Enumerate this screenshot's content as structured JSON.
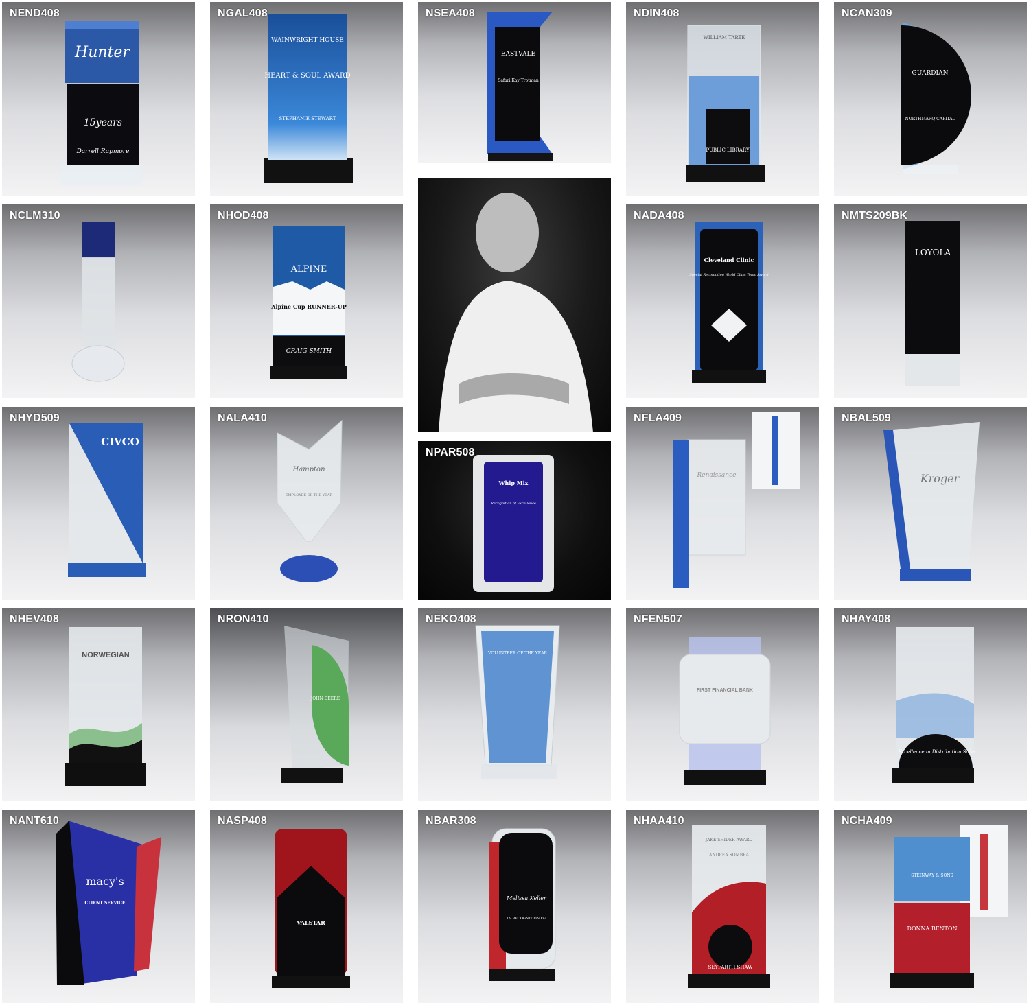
{
  "tiles": [
    {
      "code": "NEND408",
      "text": [
        "Hunter",
        "15years",
        "Darrell Rapmore"
      ]
    },
    {
      "code": "NGAL408",
      "text": [
        "WAINWRIGHT HOUSE",
        "HEART & SOUL AWARD",
        "STEPHANIE STEWART"
      ]
    },
    {
      "code": "NSEA408",
      "text": [
        "EASTVALE",
        "Safari Kay Trotman"
      ]
    },
    {
      "code": "NDIN408",
      "text": [
        "WILLIAM TARTE",
        "PUBLIC LIBRARY"
      ]
    },
    {
      "code": "NCAN309",
      "text": [
        "GUARDIAN",
        "NORTHMARQ CAPITAL"
      ]
    },
    {
      "code": "NCLM310",
      "text": []
    },
    {
      "code": "NHOD408",
      "text": [
        "ALPINE",
        "Alpine Cup RUNNER-UP",
        "CRAIG SMITH"
      ]
    },
    {
      "code": "NADA408",
      "text": [
        "Cleveland Clinic",
        "Special Recognition World Class Team Award"
      ]
    },
    {
      "code": "NMTS209BK",
      "text": [
        "LOYOLA"
      ]
    },
    {
      "code": "NHYD509",
      "text": [
        "CIVCO"
      ]
    },
    {
      "code": "NALA410",
      "text": [
        "Hampton",
        "EMPLOYEE OF THE YEAR"
      ]
    },
    {
      "code": "NPAR508",
      "text": [
        "Whip Mix",
        "Recognition of Excellence"
      ]
    },
    {
      "code": "NFLA409",
      "text": [
        "Renaissance"
      ]
    },
    {
      "code": "NBAL509",
      "text": [
        "Kroger"
      ]
    },
    {
      "code": "NHEV408",
      "text": [
        "NORWEGIAN"
      ]
    },
    {
      "code": "NRON410",
      "text": [
        "JOHN DEERE"
      ]
    },
    {
      "code": "NEKO408",
      "text": [
        "VOLUNTEER OF THE YEAR"
      ]
    },
    {
      "code": "NFEN507",
      "text": [
        "FIRST FINANCIAL BANK"
      ]
    },
    {
      "code": "NHAY408",
      "text": [
        "Excellence in Distribution Sales"
      ]
    },
    {
      "code": "NANT610",
      "text": [
        "macy's",
        "CLIENT SERVICE"
      ]
    },
    {
      "code": "NASP408",
      "text": [
        "VALSTAR"
      ]
    },
    {
      "code": "NBAR308",
      "text": [
        "Melissa Keller",
        "IN RECOGNITION OF"
      ]
    },
    {
      "code": "NHAA410",
      "text": [
        "JAKE SHIDER AWARD",
        "ANDREA SOMBRA",
        "SEYFARTH SHAW"
      ]
    },
    {
      "code": "NCHA409",
      "text": [
        "STEINWAY & SONS",
        "DONNA BENTON"
      ]
    }
  ]
}
